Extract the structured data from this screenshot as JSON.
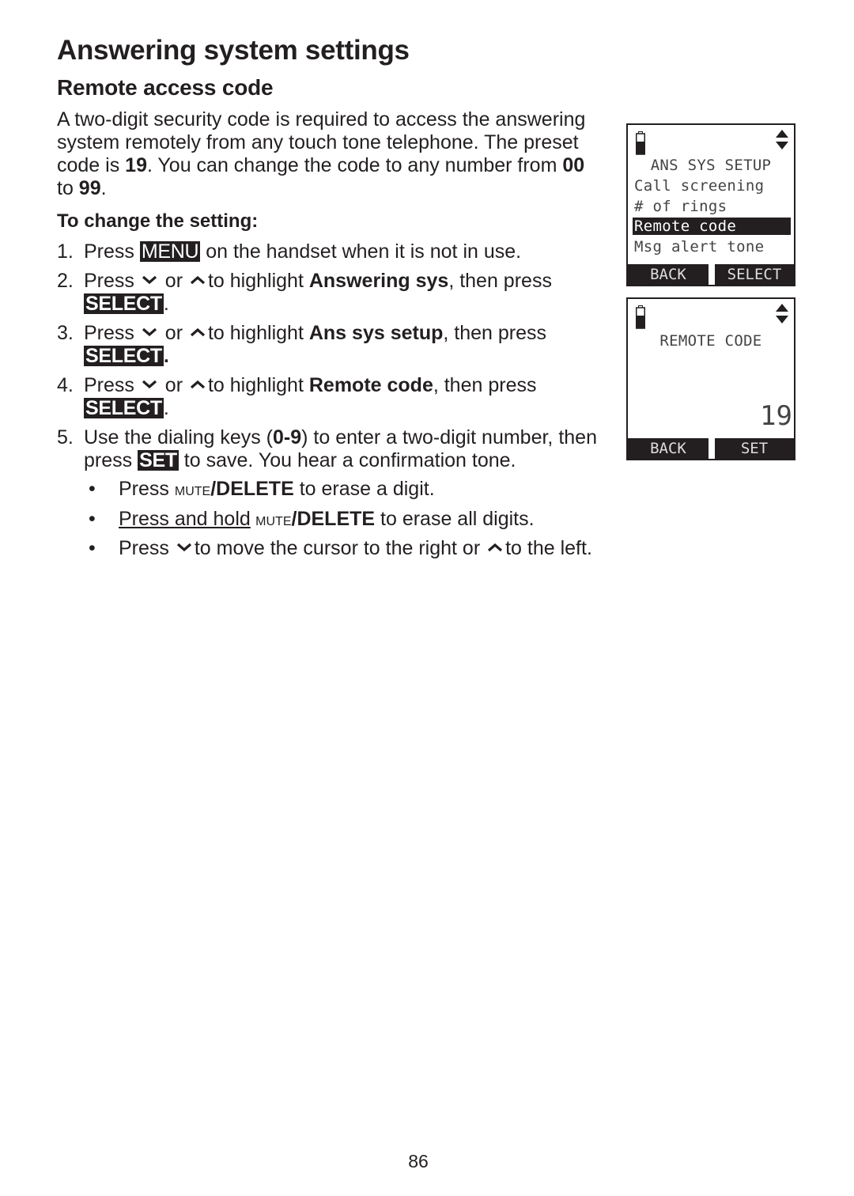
{
  "page": {
    "title": "Answering system settings",
    "section_title": "Remote access code",
    "intro": {
      "p1": "A two-digit security code is required to access the answering system remotely from any touch tone telephone. The preset code is ",
      "preset_code": "19",
      "p2": ". You can change the code to any number from ",
      "range_min": "00",
      "p3": " to ",
      "range_max": "99",
      "p4": "."
    },
    "subheading": "To change the setting:",
    "steps": [
      {
        "num": "1.",
        "a": "Press ",
        "key": "MENU",
        "b": " on the handset when it is not in use."
      },
      {
        "num": "2.",
        "a": "Press ",
        "or": " or ",
        "c": "to highlight ",
        "target": "Answering sys",
        "d": ", then press ",
        "key": "SELECT",
        "e": "."
      },
      {
        "num": "3.",
        "a": "Press ",
        "or": " or ",
        "c": "to highlight ",
        "target": "Ans sys setup",
        "d": ", then press ",
        "key": "SELECT",
        "e": "."
      },
      {
        "num": "4.",
        "a": "Press ",
        "or": " or ",
        "c": "to highlight ",
        "target": "Remote code",
        "d": ", then press ",
        "key": "SELECT",
        "e": "."
      },
      {
        "num": "5.",
        "a": "Use the dialing keys (",
        "keys": "0-9",
        "b": ") to enter a two-digit number, then press ",
        "key": "SET",
        "c": " to save. You hear a confirmation tone."
      }
    ],
    "bullets": [
      {
        "dot": "•",
        "a": "Press ",
        "mute": "mute",
        "delete": "/DELETE",
        "b": " to erase a digit."
      },
      {
        "dot": "•",
        "u": "Press and hold",
        "mute": " mute",
        "delete": "/DELETE",
        "b": " to erase all digits."
      },
      {
        "dot": "•",
        "a": "Press ",
        "b": "to move the cursor to the right or ",
        "c": "to the left."
      }
    ],
    "page_number": "86"
  },
  "screens": [
    {
      "icons": [
        "battery-icon",
        "scroll-arrows-icon"
      ],
      "title": "ANS SYS SETUP",
      "items": [
        "Call screening",
        "# of rings",
        "Remote code",
        "Msg alert tone"
      ],
      "highlighted_index": 2,
      "softkeys": {
        "left": "BACK",
        "right": "SELECT"
      }
    },
    {
      "icons": [
        "battery-icon",
        "scroll-arrows-icon"
      ],
      "title": "REMOTE CODE",
      "value": "19",
      "softkeys": {
        "left": "BACK",
        "right": "SET"
      }
    }
  ]
}
